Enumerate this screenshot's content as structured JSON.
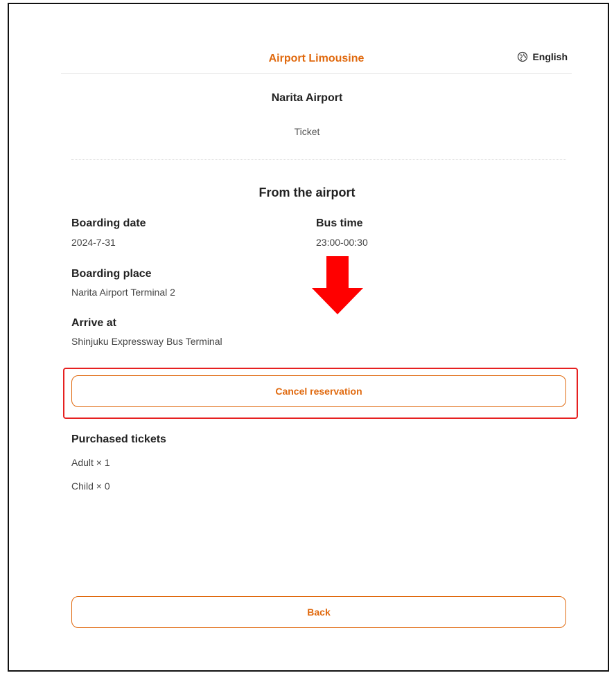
{
  "header": {
    "brand": "Airport Limousine",
    "language": "English",
    "language_icon": "globe-icon",
    "brand_color": "#e0690e"
  },
  "airport": "Narita Airport",
  "ticket_label": "Ticket",
  "direction": "From the airport",
  "details": {
    "boarding_date_label": "Boarding date",
    "boarding_date": "2024-7-31",
    "bus_time_label": "Bus time",
    "bus_time": "23:00-00:30",
    "boarding_place_label": "Boarding place",
    "boarding_place": "Narita Airport Terminal 2",
    "arrive_at_label": "Arrive at",
    "arrive_at": "Shinjuku Expressway Bus Terminal"
  },
  "annotation": {
    "arrow_icon": "arrow-down-icon",
    "arrow_color": "#ff0000",
    "highlight_color": "#e62020"
  },
  "actions": {
    "cancel_label": "Cancel reservation",
    "back_label": "Back"
  },
  "purchased": {
    "title": "Purchased tickets",
    "items": [
      "Adult × 1",
      "Child × 0"
    ]
  }
}
